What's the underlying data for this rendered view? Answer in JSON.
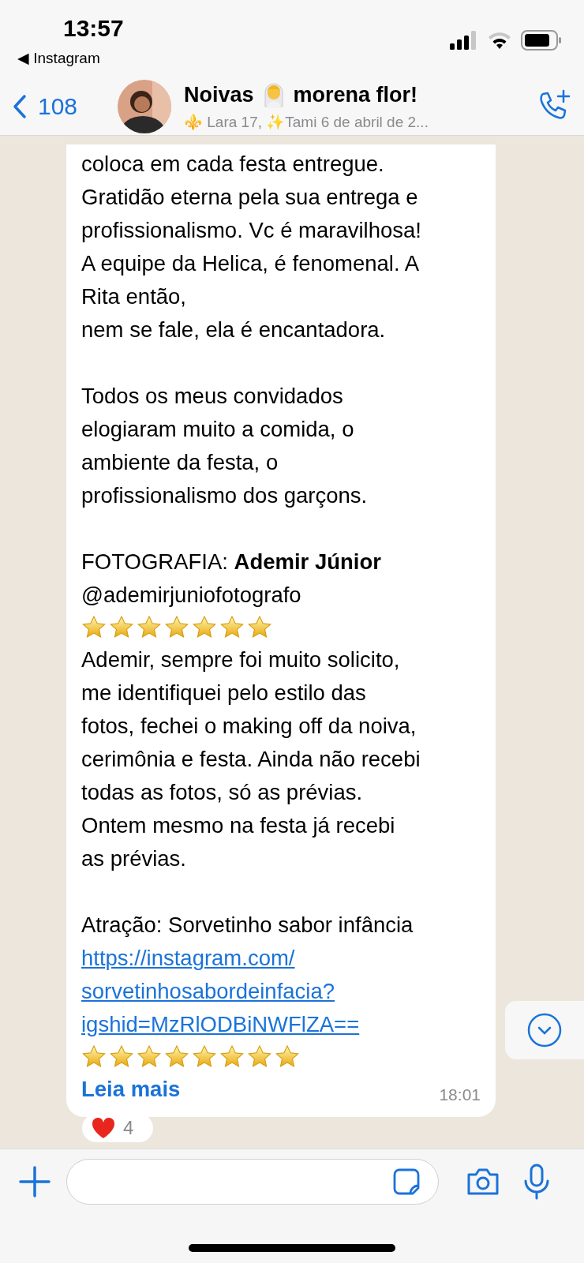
{
  "status_bar": {
    "time": "13:57",
    "back_app": "◀ Instagram"
  },
  "header": {
    "back_count": "108",
    "title_start": "Noivas",
    "title_end": "morena flor!",
    "subtitle": "⚜️ Lara 17, ✨Tami 6 de abril de 2..."
  },
  "message": {
    "blocks": [
      {
        "kind": "text",
        "text": "coloca em cada festa entregue.\nGratidão eterna pela sua entrega e\nprofissionalismo. Vc é maravilhosa!\nA equipe da Helica, é fenomenal. A\nRita então,\nnem se fale, ela é encantadora."
      },
      {
        "kind": "gap"
      },
      {
        "kind": "text",
        "text": "Todos os meus convidados\nelogiaram muito a comida, o\nambiente da festa, o\nprofissionalismo dos garçons."
      },
      {
        "kind": "gap"
      },
      {
        "kind": "text",
        "text": "FOTOGRAFIA: **Ademir Júnior**\n@ademirjuniofotografo"
      },
      {
        "kind": "stars",
        "stars": 7
      },
      {
        "kind": "text",
        "text": "Ademir, sempre foi muito solicito,\nme identifiquei pelo estilo das\nfotos, fechei o making off da noiva,\ncerimônia e festa. Ainda não recebi\ntodas as fotos, só as prévias.\nOntem mesmo na festa já recebi\nas prévias."
      },
      {
        "kind": "gap"
      },
      {
        "kind": "text",
        "text": "Atração: Sorvetinho sabor infância"
      },
      {
        "kind": "link",
        "text": "https://instagram.com/\nsorvetinhosabordeinfacia?\nigshid=MzRlODBiNWFlZA=="
      },
      {
        "kind": "stars",
        "stars": 8
      }
    ],
    "read_more": "Leia mais",
    "time": "18:01",
    "reaction_count": "4"
  }
}
